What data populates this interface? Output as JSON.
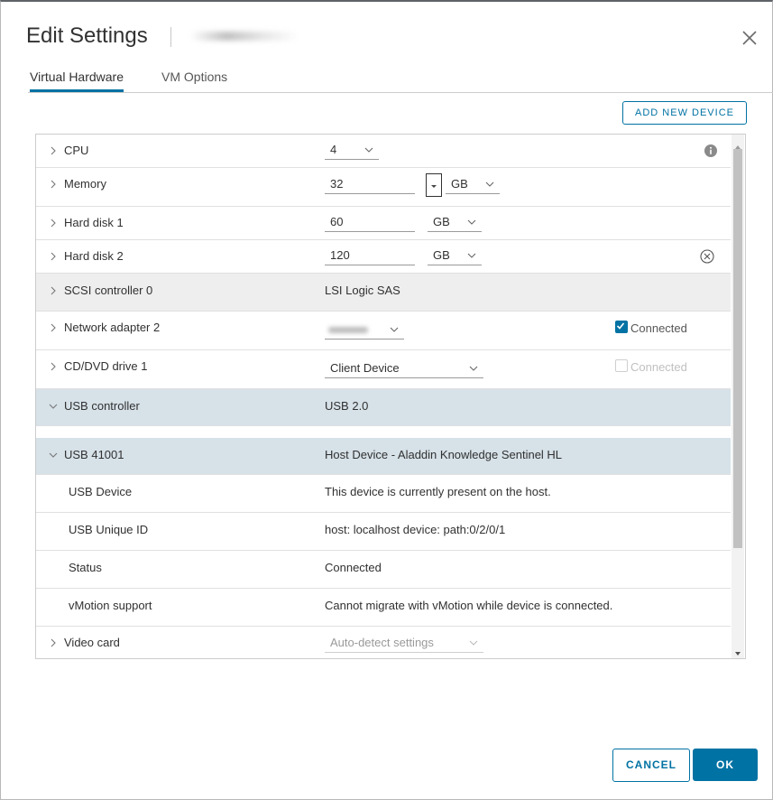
{
  "dialog": {
    "title": "Edit Settings",
    "close_icon": "close-icon"
  },
  "tabs": [
    {
      "label": "Virtual Hardware",
      "active": true
    },
    {
      "label": "VM Options",
      "active": false
    }
  ],
  "add_device_label": "ADD NEW DEVICE",
  "rows": {
    "cpu": {
      "label": "CPU",
      "value": "4"
    },
    "memory": {
      "label": "Memory",
      "value": "32",
      "unit": "GB"
    },
    "disk1": {
      "label": "Hard disk 1",
      "value": "60",
      "unit": "GB"
    },
    "disk2": {
      "label": "Hard disk 2",
      "value": "120",
      "unit": "GB"
    },
    "scsi": {
      "label": "SCSI controller 0",
      "value": "LSI Logic SAS"
    },
    "net": {
      "label": "Network adapter 2",
      "checkbox_label": "Connected",
      "checked": true
    },
    "cd": {
      "label": "CD/DVD drive 1",
      "value": "Client Device",
      "checkbox_label": "Connected",
      "checked": false
    },
    "usbctrl": {
      "label": "USB controller",
      "value": "USB 2.0"
    },
    "usbdev": {
      "label": "USB 41001",
      "value": "Host Device - Aladdin Knowledge Sentinel HL"
    },
    "usb_device": {
      "label": "USB Device",
      "value": "This device is currently present on the host."
    },
    "usb_uid": {
      "label": "USB Unique ID",
      "value": "host: localhost device: path:0/2/0/1"
    },
    "usb_status": {
      "label": "Status",
      "value": "Connected"
    },
    "usb_vmotion": {
      "label": "vMotion support",
      "value": "Cannot migrate with vMotion while device is connected."
    },
    "video": {
      "label": "Video card",
      "value": "Auto-detect settings"
    }
  },
  "footer": {
    "cancel_label": "CANCEL",
    "ok_label": "OK"
  },
  "colors": {
    "accent": "#0072a3",
    "expanded_row": "#d6e1e8",
    "gray_row": "#eeeeee"
  }
}
